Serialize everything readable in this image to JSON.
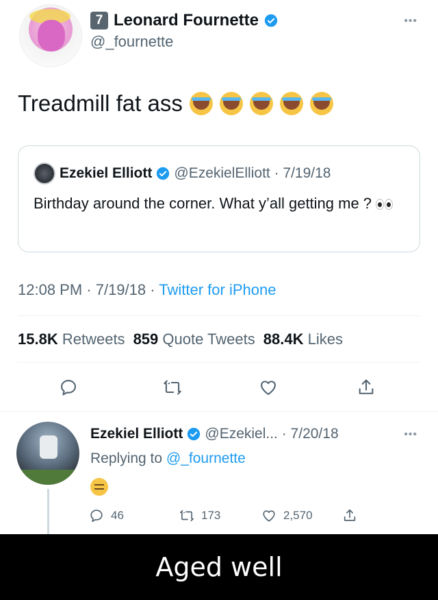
{
  "tweet": {
    "author_badge": "7",
    "author_name": "Leonard Fournette",
    "author_handle": "@_fournette",
    "text": "Treadmill fat ass",
    "emoji_count": 5
  },
  "quote": {
    "name": "Ezekiel Elliott",
    "handle_date": "@EzekielElliott · 7/19/18",
    "text": "Birthday around the corner. What y’all getting me ?"
  },
  "meta": {
    "time_date": "12:08 PM · 7/19/18 · ",
    "source": "Twitter for iPhone"
  },
  "stats": {
    "retweets_count": "15.8K",
    "retweets_label": "Retweets",
    "quotes_count": "859",
    "quotes_label": "Quote Tweets",
    "likes_count": "88.4K",
    "likes_label": "Likes"
  },
  "reply": {
    "name": "Ezekiel Elliott",
    "handle_date": "@Ezekiel... · 7/20/18",
    "replying_prefix": "Replying to ",
    "replying_handle": "@_fournette",
    "reply_count": "46",
    "retweet_count": "173",
    "like_count": "2,570"
  },
  "caption": "Aged well",
  "colors": {
    "link": "#1d9bf0",
    "secondary": "#536471",
    "verified": "#1d9bf0"
  }
}
